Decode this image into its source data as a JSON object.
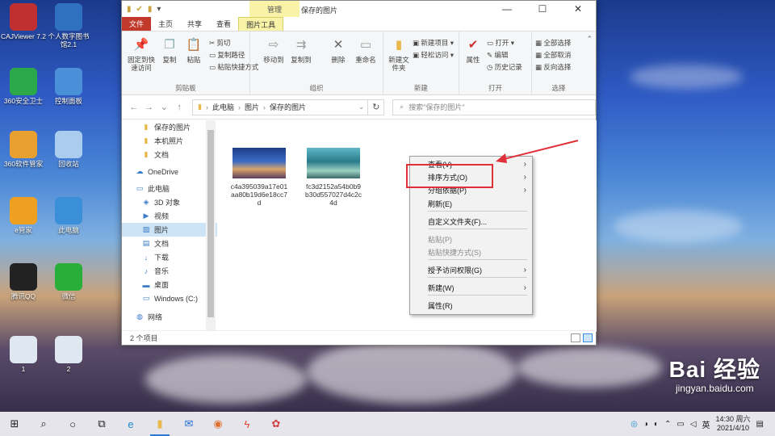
{
  "desktop": {
    "icons": [
      {
        "label": "CAJViewer 7.2",
        "icon": "cajviewer-icon",
        "color": "#c03030"
      },
      {
        "label": "个人数字图书馆2.1",
        "icon": "library-icon",
        "color": "#3070c0"
      },
      {
        "label": "360安全卫士",
        "icon": "360-safe-icon",
        "color": "#2aa84a"
      },
      {
        "label": "控制面板",
        "icon": "control-panel-icon",
        "color": "#4a90d9"
      },
      {
        "label": "360软件管家",
        "icon": "360-software-icon",
        "color": "#e8a030"
      },
      {
        "label": "回收站",
        "icon": "recycle-bin-icon",
        "color": "#aaccee"
      },
      {
        "label": "e管家",
        "icon": "e-butler-icon",
        "color": "#f0a020"
      },
      {
        "label": "此电脑",
        "icon": "this-pc-icon",
        "color": "#3b8ed8"
      },
      {
        "label": "腾讯QQ",
        "icon": "qq-icon",
        "color": "#222222"
      },
      {
        "label": "微信",
        "icon": "wechat-icon",
        "color": "#2aae3a"
      },
      {
        "label": "1",
        "icon": "image-file-icon",
        "color": "#dfe8f0"
      },
      {
        "label": "2",
        "icon": "image-file-icon",
        "color": "#dfe8f0"
      }
    ]
  },
  "window": {
    "context_tab": "管理",
    "title": "保存的图片",
    "tabs": [
      "文件",
      "主页",
      "共享",
      "查看",
      "图片工具"
    ],
    "ribbon": {
      "clipboard": {
        "pin": "固定到快速访问",
        "copy": "复制",
        "paste": "粘贴",
        "cut": "剪切",
        "copy_path": "复制路径",
        "paste_shortcut": "粘贴快捷方式",
        "label": "剪贴板"
      },
      "organize": {
        "move_to": "移动到",
        "copy_to": "复制到",
        "delete": "删除",
        "rename": "重命名",
        "label": "组织"
      },
      "new": {
        "new_folder": "新建文件夹",
        "new_item": "新建项目",
        "easy_access": "轻松访问",
        "label": "新建"
      },
      "open": {
        "properties": "属性",
        "open": "打开",
        "edit": "编辑",
        "history": "历史记录",
        "label": "打开"
      },
      "select": {
        "select_all": "全部选择",
        "select_none": "全部取消",
        "invert": "反向选择",
        "label": "选择"
      }
    },
    "path": [
      "此电脑",
      "图片",
      "保存的图片"
    ],
    "search_placeholder": "搜索\"保存的图片\"",
    "nav_items": [
      {
        "label": "保存的图片",
        "icon": "folder-icon"
      },
      {
        "label": "本机照片",
        "icon": "folder-icon"
      },
      {
        "label": "文档",
        "icon": "folder-icon"
      },
      {
        "label": "OneDrive",
        "icon": "cloud-icon"
      },
      {
        "label": "此电脑",
        "icon": "pc-icon"
      },
      {
        "label": "3D 对象",
        "icon": "cube-icon"
      },
      {
        "label": "视频",
        "icon": "video-icon"
      },
      {
        "label": "图片",
        "icon": "picture-icon"
      },
      {
        "label": "文档",
        "icon": "document-icon"
      },
      {
        "label": "下载",
        "icon": "download-icon"
      },
      {
        "label": "音乐",
        "icon": "music-icon"
      },
      {
        "label": "桌面",
        "icon": "desktop-icon"
      },
      {
        "label": "Windows (C:)",
        "icon": "drive-icon"
      },
      {
        "label": "网络",
        "icon": "network-icon"
      }
    ],
    "files": [
      {
        "name": "c4a395039a17e01aa80b19d6e18cc7d"
      },
      {
        "name": "fc3d2152a54b0b9b30d557027d4c2c4d"
      }
    ],
    "status": "2 个项目"
  },
  "context_menu": {
    "items": [
      {
        "label": "查看(V)",
        "submenu": true,
        "disabled": false
      },
      {
        "label": "排序方式(O)",
        "submenu": true,
        "disabled": false
      },
      {
        "label": "分组依据(P)",
        "submenu": true,
        "disabled": false
      },
      {
        "label": "刷新(E)",
        "submenu": false,
        "disabled": false
      },
      {
        "label": "自定义文件夹(F)...",
        "submenu": false,
        "disabled": false
      },
      {
        "label": "粘贴(P)",
        "submenu": false,
        "disabled": true
      },
      {
        "label": "粘贴快捷方式(S)",
        "submenu": false,
        "disabled": true
      },
      {
        "label": "授予访问权限(G)",
        "submenu": true,
        "disabled": false
      },
      {
        "label": "新建(W)",
        "submenu": true,
        "disabled": false
      },
      {
        "label": "属性(R)",
        "submenu": false,
        "disabled": false
      }
    ],
    "highlight_color": "#e0303a"
  },
  "taskbar": {
    "icons": [
      "windows-start-icon",
      "search-icon",
      "cortana-icon",
      "task-view-icon",
      "edge-icon",
      "file-explorer-icon",
      "mail-icon",
      "app-icon",
      "wps-icon",
      "tool-icon"
    ],
    "tray_lang": "英",
    "time": "14:30 周六",
    "date": "2021/4/10"
  },
  "watermark": {
    "brand": "Bai 经验",
    "url": "jingyan.baidu.com"
  }
}
